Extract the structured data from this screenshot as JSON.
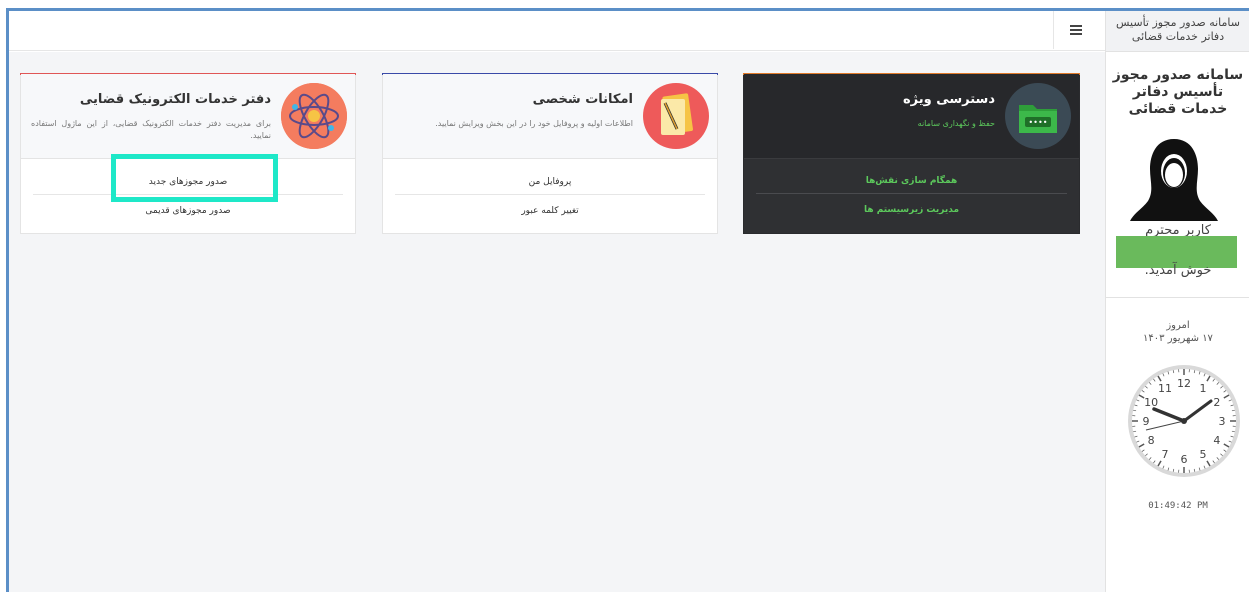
{
  "app": {
    "header_title_line1": "سامانه صدور مجوز تأسیس",
    "header_title_line2": "دفاتر خدمات قضائی",
    "menu_icon": "hamburger-icon"
  },
  "sidebar": {
    "title": "سامانه صدور مجوز تأسیس دفاتر خدمات قضائی",
    "user_greeting": "کاربر محترم",
    "welcome": "خوش آمدید.",
    "today_label": "امروز",
    "date": "۱۷ شهریور ۱۴۰۳",
    "time": "01:49:42 PM",
    "clock_numbers": [
      "12",
      "1",
      "2",
      "3",
      "4",
      "5",
      "6",
      "7",
      "8",
      "9",
      "10",
      "11"
    ],
    "redaction_color": "#6aba5c"
  },
  "cards": {
    "judicial": {
      "title": "دفتر خدمات الکترونیک قضایی",
      "description": "برای مدیریت دفتر خدمات الکترونیک قضایی، از این ماژول استفاده نمایید.",
      "icon": "atom-icon",
      "accent": "#e05656",
      "items": [
        "صدور مجوزهای جدید",
        "صدور مجوزهای قدیمی"
      ]
    },
    "personal": {
      "title": "امکانات شخصی",
      "description": "اطلاعات اولیه و پروفایل خود را در این بخش ویرایش نمایید.",
      "icon": "notebook-icon",
      "accent": "#3a4aa8",
      "items": [
        "پروفایل من",
        "تغییر کلمه عبور"
      ]
    },
    "special": {
      "title": "دسترسی ویژه",
      "description": "حفظ و نگهداری سامانه",
      "icon": "password-folder-icon",
      "accent": "#e07a2a",
      "items": [
        "همگام سازی نقش‌ها",
        "مدیریت زیرسیستم ها"
      ]
    }
  },
  "highlight_color": "#1ee8c8"
}
